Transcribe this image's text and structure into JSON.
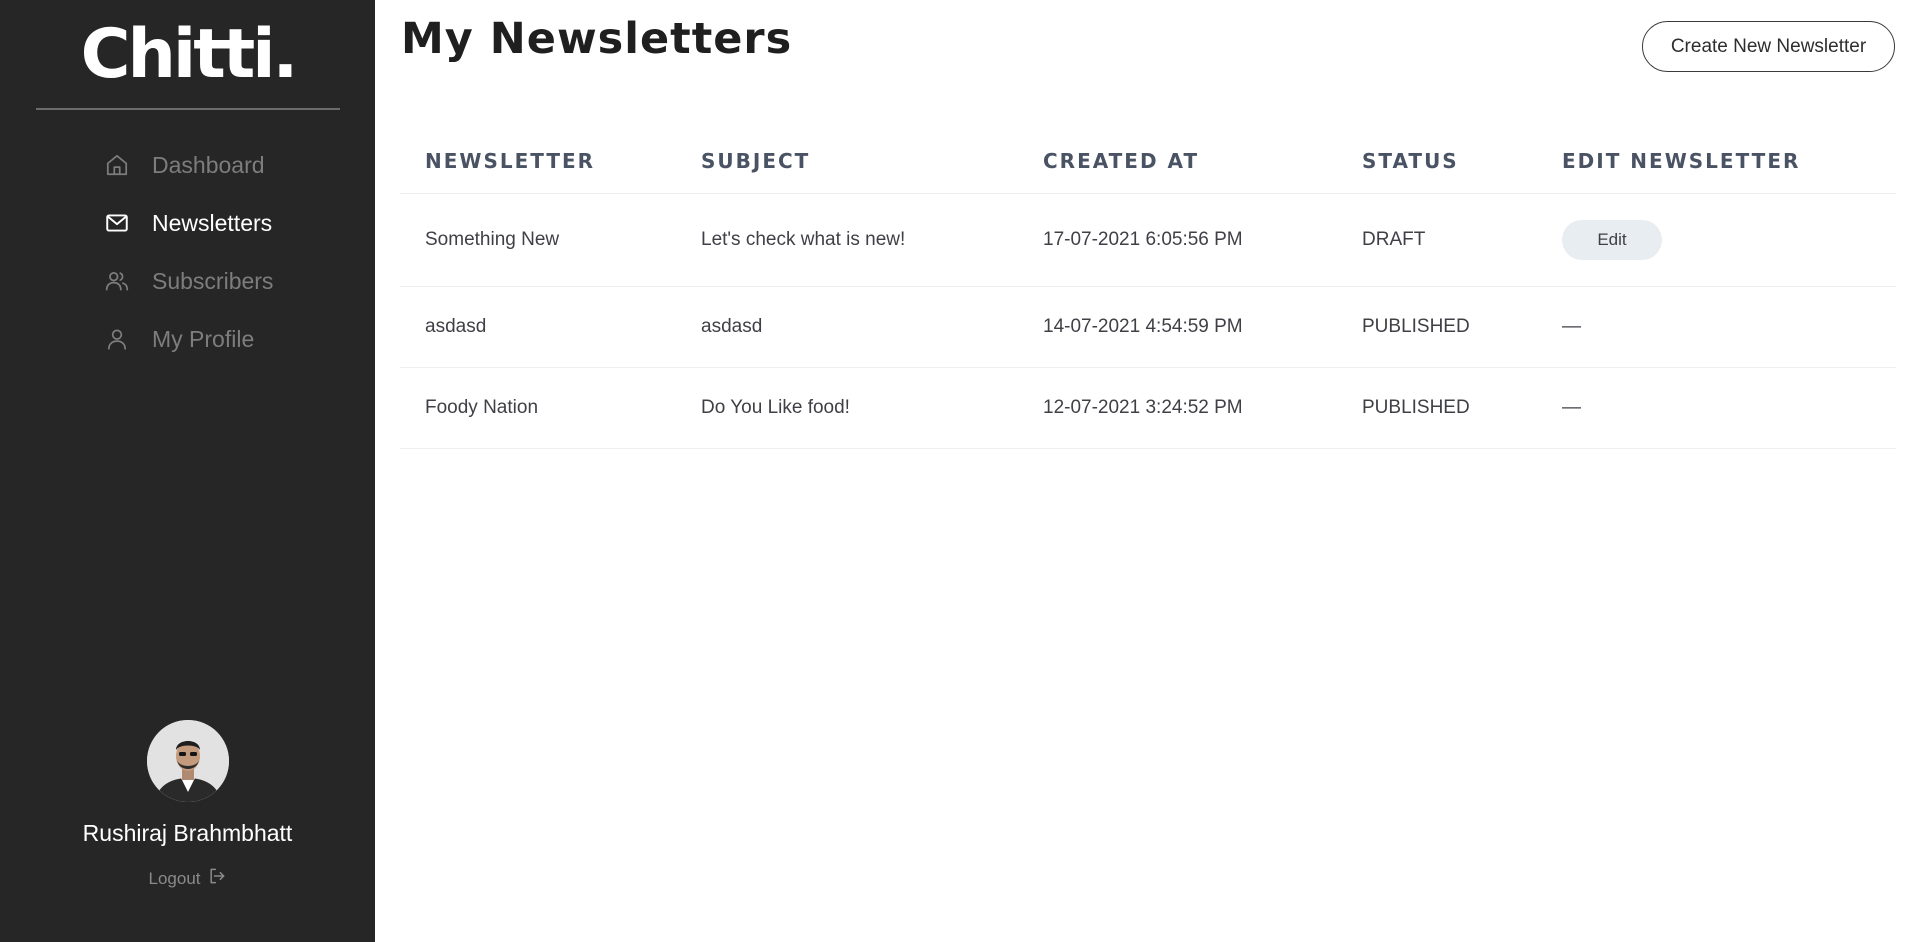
{
  "app": {
    "logo": "Chitti."
  },
  "sidebar": {
    "items": [
      {
        "label": "Dashboard",
        "icon": "home-icon",
        "active": false
      },
      {
        "label": "Newsletters",
        "icon": "mail-icon",
        "active": true
      },
      {
        "label": "Subscribers",
        "icon": "users-icon",
        "active": false
      },
      {
        "label": "My Profile",
        "icon": "user-icon",
        "active": false
      }
    ],
    "user": {
      "name": "Rushiraj Brahmbhatt",
      "logout_label": "Logout"
    }
  },
  "main": {
    "title": "My Newsletters",
    "create_button": "Create New Newsletter",
    "table": {
      "columns": [
        "NEWSLETTER",
        "SUBJECT",
        "CREATED AT",
        "STATUS",
        "EDIT NEWSLETTER"
      ],
      "rows": [
        {
          "newsletter": "Something New",
          "subject": "Let's check what is new!",
          "created_at": "17-07-2021 6:05:56 PM",
          "status": "DRAFT",
          "edit": "Edit"
        },
        {
          "newsletter": "asdasd",
          "subject": "asdasd",
          "created_at": "14-07-2021 4:54:59 PM",
          "status": "PUBLISHED",
          "edit": "—"
        },
        {
          "newsletter": "Foody Nation",
          "subject": "Do You Like food!",
          "created_at": "12-07-2021 3:24:52 PM",
          "status": "PUBLISHED",
          "edit": "—"
        }
      ]
    }
  },
  "colors": {
    "sidebar_bg": "#262626",
    "active_nav": "#ffffff",
    "inactive_nav": "#7d7d7d",
    "header_text": "#4a5364",
    "edit_button_bg": "#e8edf2"
  }
}
